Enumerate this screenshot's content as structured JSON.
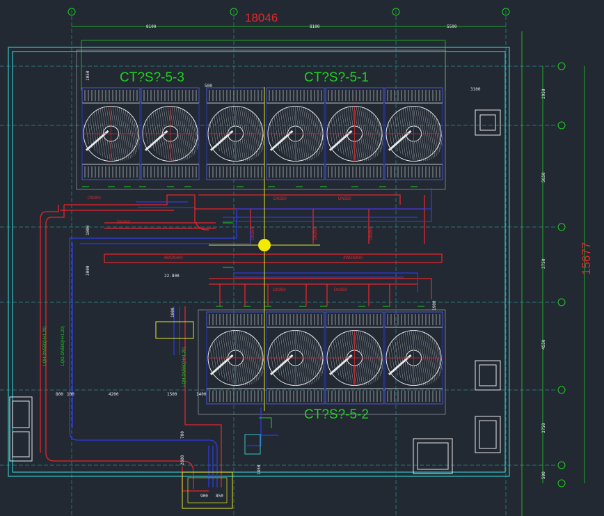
{
  "drawing": {
    "overall_width_dim": "18046",
    "overall_height_dim": "15677",
    "top_grid_bubbles": [
      "",
      "",
      "",
      ""
    ],
    "right_grid_bubbles": [
      "",
      "",
      "",
      "",
      "",
      ""
    ],
    "top_dims": [
      "8100",
      "8100",
      "5500"
    ],
    "right_dims": [
      "2950",
      "5650",
      "3750",
      "4550",
      "3750",
      "500"
    ],
    "tower_labels": {
      "top_left": "CT?S?-5-3",
      "top_right": "CT?S?-5-1",
      "bottom": "CT?S?-5-2"
    },
    "pipe_labels": {
      "dn300_a": "DN300",
      "dn300_b": "DN300",
      "dn350_a": "DN350",
      "dn350_b": "DN350",
      "dn350_c": "DN350",
      "dn350_d": "DN350",
      "dn400_left": "4WDN400",
      "dn400_right": "4WDN400",
      "dn350_v1": "DN350",
      "dn350_v2": "DN350",
      "dn350_v3": "DN350"
    },
    "riser_labels": {
      "left_outer": "LQH-DN550(H+1.20)",
      "left_inner": "LQG-DN500(H+1.20)",
      "valve_riser": "LQH-DN550(H+1.20)"
    },
    "misc_dims": {
      "d1050": "1050",
      "d500": "500",
      "d3100": "3100",
      "d1000": "1000",
      "d3000": "3000",
      "d800": "800",
      "d100": "100",
      "d4200": "4200",
      "d1500": "1500",
      "d1400": "1400",
      "d1000b": "1000",
      "d700": "700",
      "d2600": "2600",
      "d900": "900",
      "d850": "850",
      "d1450": "1450",
      "d1900": "1900",
      "elev": "22.800"
    }
  }
}
